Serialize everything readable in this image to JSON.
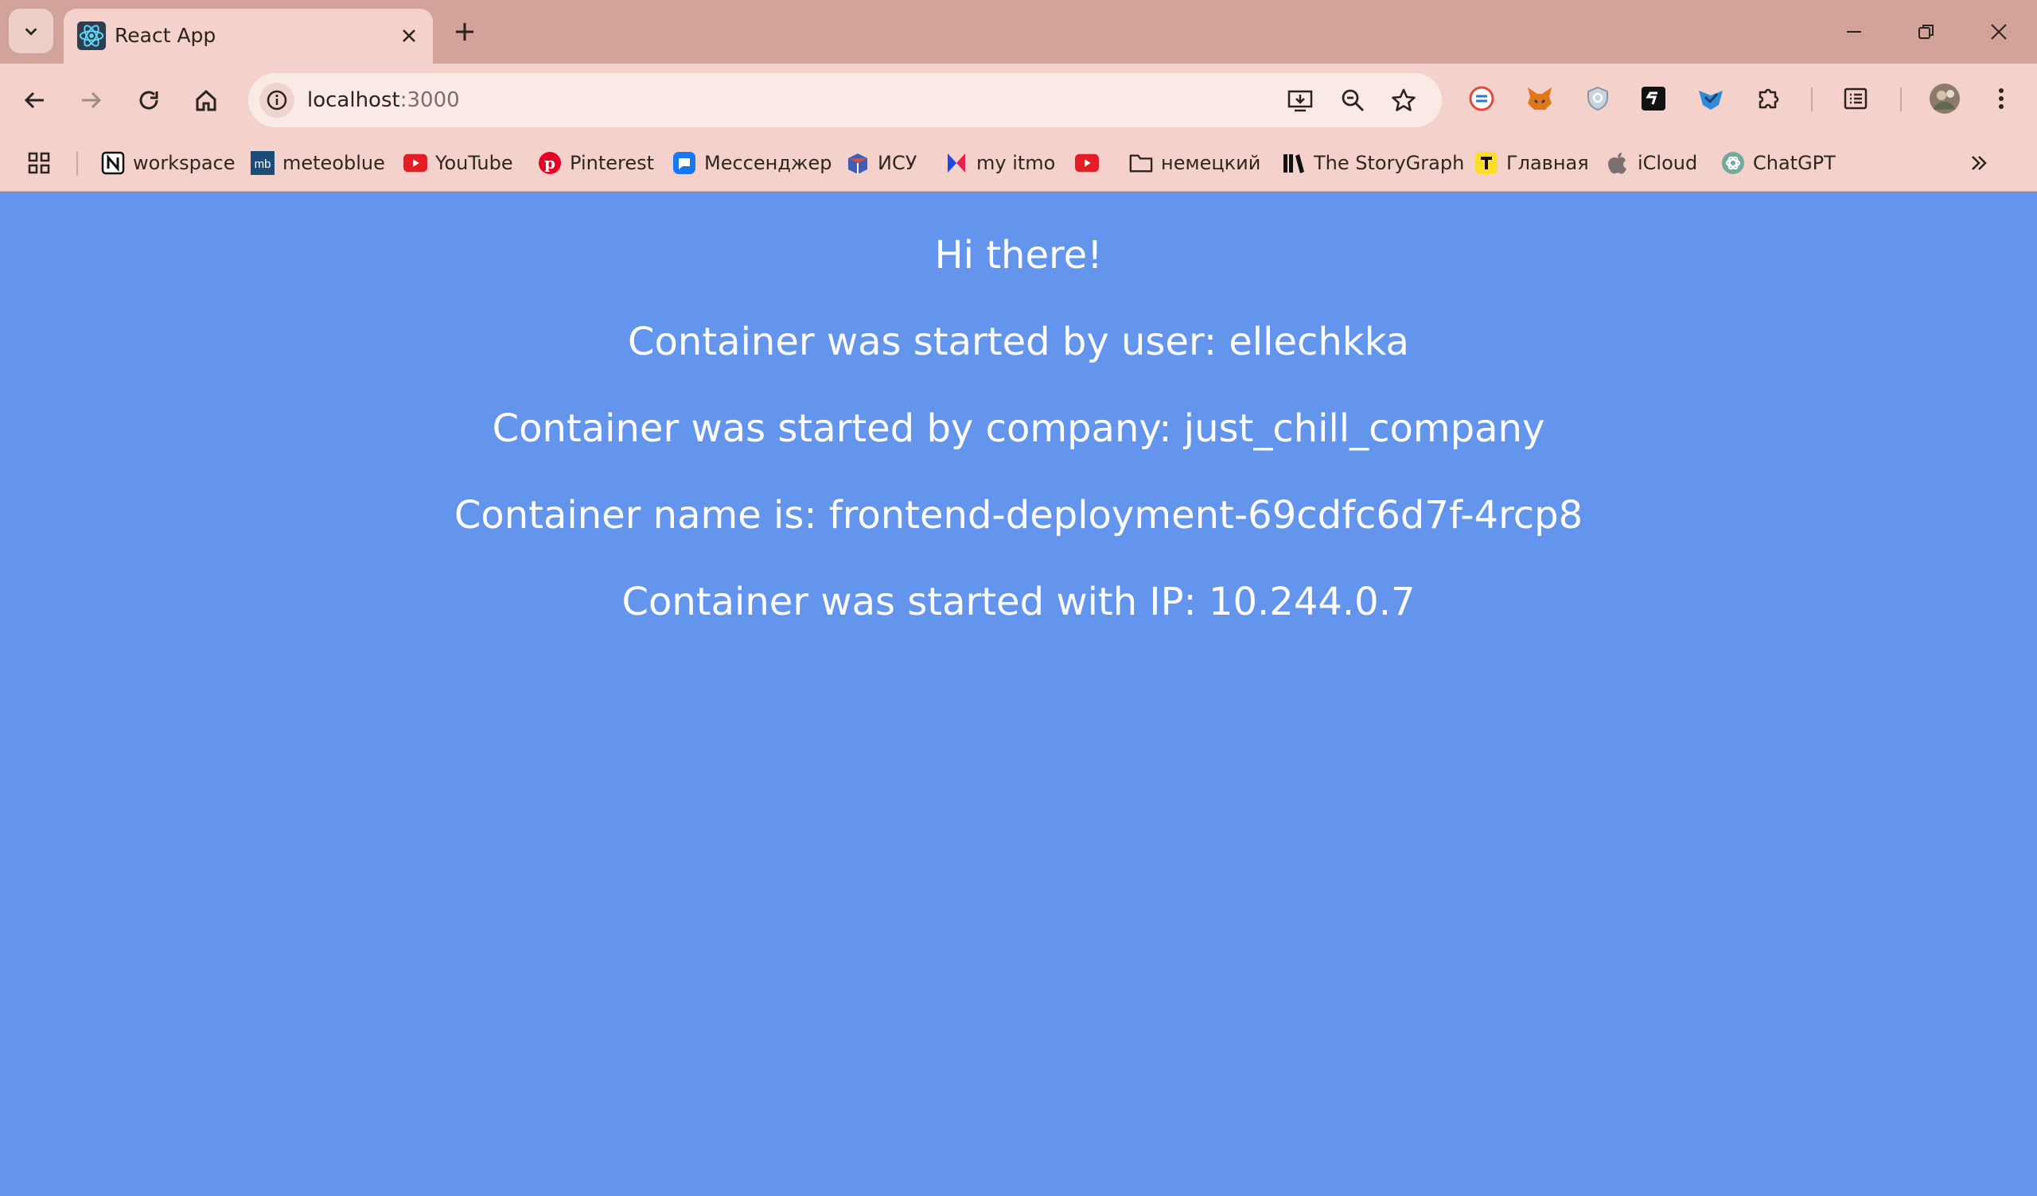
{
  "tab": {
    "title": "React App"
  },
  "address": {
    "host": "localhost",
    "port": ":3000"
  },
  "bookmarks": [
    {
      "label": "workspace",
      "icon": "notion-icon"
    },
    {
      "label": "meteoblue",
      "icon": "meteoblue-icon"
    },
    {
      "label": "YouTube",
      "icon": "youtube-icon"
    },
    {
      "label": "Pinterest",
      "icon": "pinterest-icon"
    },
    {
      "label": "Мессенджер",
      "icon": "messenger-icon"
    },
    {
      "label": "ИСУ",
      "icon": "isu-icon"
    },
    {
      "label": "my itmo",
      "icon": "itmo-icon"
    },
    {
      "label": "",
      "icon": "youtube-icon"
    },
    {
      "label": "немецкий",
      "icon": "folder-icon"
    },
    {
      "label": "The StoryGraph",
      "icon": "storygraph-icon"
    },
    {
      "label": "Главная",
      "icon": "tinkoff-icon"
    },
    {
      "label": "iCloud",
      "icon": "apple-icon"
    },
    {
      "label": "ChatGPT",
      "icon": "chatgpt-icon"
    }
  ],
  "page": {
    "greeting": "Hi there!",
    "user_line": "Container was started by user: ellechkka",
    "company_line": "Container was started by company: just_chill_company",
    "name_line": "Container name is: frontend-deployment-69cdfc6d7f-4rcp8",
    "ip_line": "Container was started with IP: 10.244.0.7"
  },
  "colors": {
    "titlebar": "#D3A298",
    "toolbar": "#F4D1CA",
    "content_bg": "#6495ED"
  }
}
